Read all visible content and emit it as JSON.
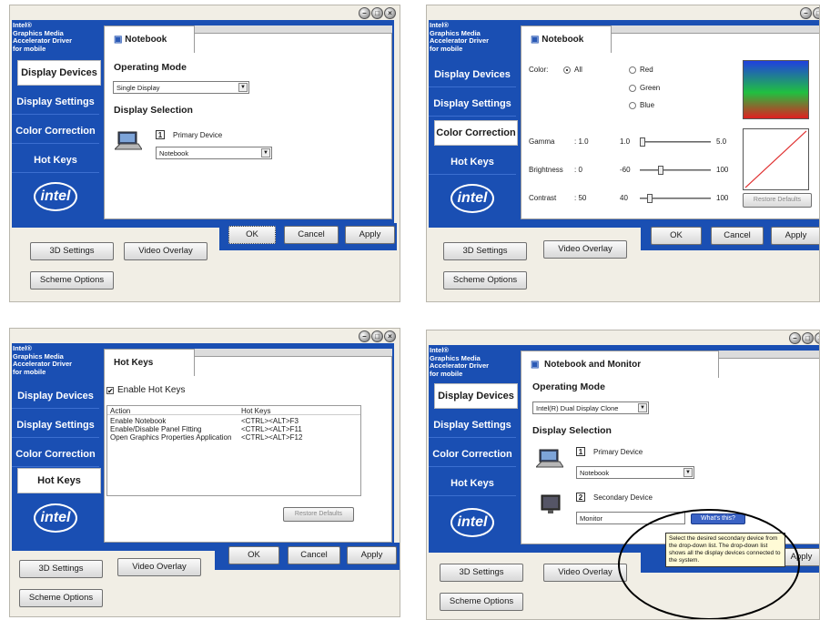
{
  "brand": {
    "lines": [
      "Intel®",
      "Graphics Media",
      "Accelerator Driver",
      "for mobile"
    ],
    "logo": "intel"
  },
  "nav": {
    "display_devices": "Display Devices",
    "display_settings": "Display Settings",
    "color_correction": "Color Correction",
    "hot_keys": "Hot Keys"
  },
  "buttons": {
    "ok": "OK",
    "cancel": "Cancel",
    "apply": "Apply",
    "settings_3d": "3D Settings",
    "video_overlay": "Video Overlay",
    "scheme_options": "Scheme Options",
    "restore_defaults": "Restore Defaults",
    "whats_this": "What's this?"
  },
  "panel1": {
    "tab": "Notebook",
    "operating_mode_label": "Operating Mode",
    "operating_mode_value": "Single Display",
    "display_selection_label": "Display Selection",
    "primary_num": "1",
    "primary_label": "Primary Device",
    "primary_value": "Notebook"
  },
  "panel2": {
    "tab": "Notebook",
    "color_label": "Color:",
    "radio_all": "All",
    "radio_red": "Red",
    "radio_green": "Green",
    "radio_blue": "Blue",
    "gamma_label": "Gamma",
    "gamma_colon": ": 1.0",
    "gamma_value": "1.0",
    "gamma_max": "5.0",
    "brightness_label": "Brightness",
    "brightness_colon": ": 0",
    "brightness_value": "-60",
    "brightness_max": "100",
    "contrast_label": "Contrast",
    "contrast_colon": ": 50",
    "contrast_value": "40",
    "contrast_max": "100"
  },
  "panel3": {
    "tab": "Hot Keys",
    "enable_label": "Enable Hot Keys",
    "col_action": "Action",
    "col_hotkeys": "Hot Keys",
    "rows": [
      {
        "action": "Enable Notebook",
        "keys": "<CTRL><ALT>F3"
      },
      {
        "action": "Enable/Disable Panel Fitting",
        "keys": "<CTRL><ALT>F11"
      },
      {
        "action": "Open Graphics Properties Application",
        "keys": "<CTRL><ALT>F12"
      }
    ]
  },
  "panel4": {
    "tab": "Notebook and Monitor",
    "operating_mode_label": "Operating Mode",
    "operating_mode_value": "Intel(R) Dual Display Clone",
    "display_selection_label": "Display Selection",
    "primary_num": "1",
    "primary_label": "Primary Device",
    "primary_value": "Notebook",
    "secondary_num": "2",
    "secondary_label": "Secondary Device",
    "secondary_value": "Monitor",
    "tooltip": "Select the desired secondary device from the drop-down list. The drop-down list shows all the display devices connected to the system."
  },
  "colors": {
    "brand_blue": "#1a4fb3",
    "window_bg": "#f1eee5"
  }
}
